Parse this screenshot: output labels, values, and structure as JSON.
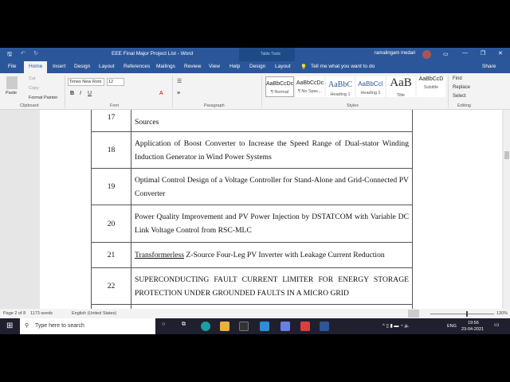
{
  "window": {
    "title": "EEE Final Major Project List  -  Word",
    "context_tab": "Table Tools",
    "user": "ramalingam medari"
  },
  "tabs": [
    "File",
    "Home",
    "Insert",
    "Design",
    "Layout",
    "References",
    "Mailings",
    "Review",
    "View",
    "Help",
    "Design",
    "Layout"
  ],
  "tell_me": "Tell me what you want to do",
  "share": "Share",
  "clipboard": {
    "paste": "Paste",
    "cut": "Cut",
    "copy": "Copy",
    "format_painter": "Format Painter",
    "label": "Clipboard"
  },
  "font": {
    "name": "Times New Rom",
    "size": "12",
    "label": "Font"
  },
  "paragraph": {
    "label": "Paragraph"
  },
  "styles": {
    "label": "Styles",
    "items": [
      {
        "preview": "AaBbCcDc",
        "name": "¶ Normal"
      },
      {
        "preview": "AaBbCcDc",
        "name": "¶ No Spac..."
      },
      {
        "preview": "AaBbC",
        "name": "Heading 1"
      },
      {
        "preview": "AaBbCcI",
        "name": "Heading 2"
      },
      {
        "preview": "AaB",
        "name": "Title"
      },
      {
        "preview": "AaBbCcD",
        "name": "Subtitle"
      }
    ]
  },
  "editing": {
    "find": "Find",
    "replace": "Replace",
    "select": "Select",
    "label": "Editing"
  },
  "rows": [
    {
      "num": "17",
      "text": "Sources"
    },
    {
      "num": "18",
      "text": "Application of Boost Converter to Increase the Speed Range of Dual-stator Winding Induction Generator in Wind Power Systems"
    },
    {
      "num": "19",
      "text": "Optimal Control Design of a Voltage Controller for Stand-Alone and Grid-Connected PV Converter"
    },
    {
      "num": "20",
      "text": "Power Quality Improvement and PV Power Injection by DSTATCOM with Variable DC Link Voltage Control from RSC-MLC"
    },
    {
      "num": "21",
      "text_underlined": "Transformerless",
      "text": " Z-Source Four-Leg PV Inverter with Leakage Current Reduction"
    },
    {
      "num": "22",
      "text": "SUPERCONDUCTING FAULT CURRENT LIMITER FOR ENERGY STORAGE PROTECTION UNDER GROUNDED FAULTS IN A MICRO GRID"
    }
  ],
  "status": {
    "page": "Page 2 of 8",
    "words": "1173 words",
    "language": "English (United States)",
    "zoom": "130%"
  },
  "taskbar": {
    "search_placeholder": "Type here to search",
    "time": "19:56",
    "date": "23-04-2021",
    "lang": "ENG"
  },
  "colors": {
    "word_blue": "#2b579a"
  }
}
